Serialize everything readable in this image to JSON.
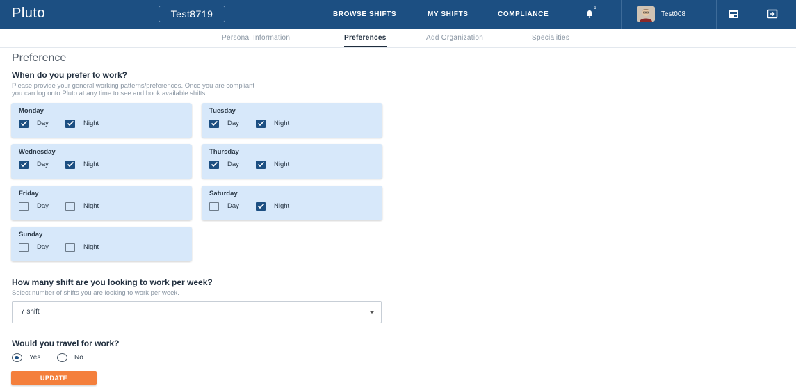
{
  "header": {
    "logo": "Pluto",
    "org": "Test8719",
    "nav": [
      "BROWSE SHIFTS",
      "MY SHIFTS",
      "COMPLIANCE"
    ],
    "notifications_badge": "5",
    "username": "Test008",
    "icons": [
      "bell-icon",
      "wallet-icon",
      "sign-out-icon"
    ]
  },
  "tabs": [
    "Personal Information",
    "Preferences",
    "Add Organization",
    "Specialities"
  ],
  "active_tab": "Preferences",
  "page_title": "Preference",
  "work_question": {
    "title": "When do you prefer to work?",
    "desc_line1": "Please provide your general working patterns/preferences. Once you are compliant",
    "desc_line2": "you can log onto Pluto at any time to see and book available shifts."
  },
  "labels": {
    "day": "Day",
    "night": "Night"
  },
  "days": [
    {
      "name": "Monday",
      "day": true,
      "night": true
    },
    {
      "name": "Tuesday",
      "day": true,
      "night": true
    },
    {
      "name": "Wednesday",
      "day": true,
      "night": true
    },
    {
      "name": "Thursday",
      "day": true,
      "night": true
    },
    {
      "name": "Friday",
      "day": false,
      "night": false
    },
    {
      "name": "Saturday",
      "day": false,
      "night": true
    },
    {
      "name": "Sunday",
      "day": false,
      "night": false
    }
  ],
  "shifts_question": {
    "title": "How many shift are you looking to work per week?",
    "desc": "Select number of shifts you are looking to work per week.",
    "selected": "7 shift"
  },
  "travel_question": {
    "title": "Would you travel for work?",
    "options": [
      "Yes",
      "No"
    ],
    "selected": "Yes"
  },
  "update_label": "UPDATE",
  "colors": {
    "header_bg": "#1c4f82",
    "card_bg": "#d7e8fa",
    "accent": "#f47f3c"
  }
}
